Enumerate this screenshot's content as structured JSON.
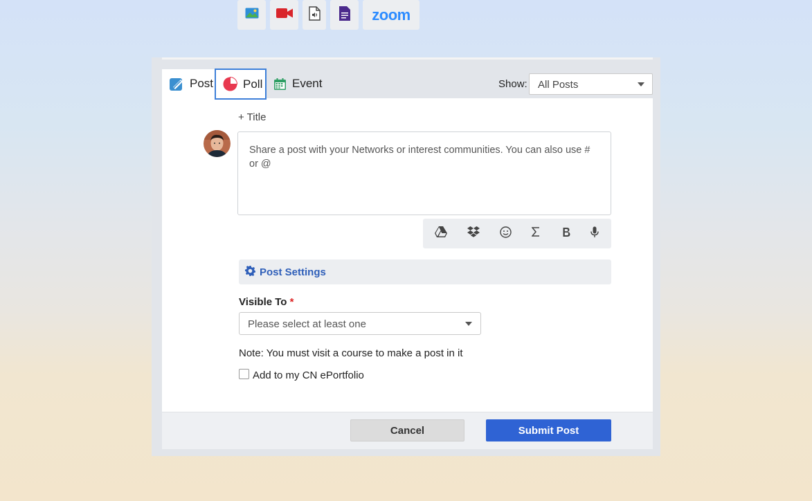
{
  "tabs": [
    {
      "label": "Post",
      "icon": "pen-square-icon"
    },
    {
      "label": "Poll",
      "icon": "pie-chart-icon",
      "selected": true
    },
    {
      "label": "Event",
      "icon": "calendar-icon"
    }
  ],
  "filter": {
    "label": "Show:",
    "value": "All Posts"
  },
  "composer": {
    "add_title": "+ Title",
    "placeholder": "Share a post with your Networks or interest communities. You can also use # or @"
  },
  "toolbar": {
    "items": [
      "image-icon",
      "video-camera-icon",
      "audio-file-icon",
      "document-icon",
      "zoom-logo",
      "google-drive-icon",
      "dropbox-icon",
      "emoji-icon",
      "sigma-icon",
      "bold-icon",
      "microphone-icon"
    ],
    "zoom_label": "zoom"
  },
  "settings": {
    "label": "Post Settings"
  },
  "visibility": {
    "label": "Visible To",
    "required_mark": "*",
    "placeholder": "Please select at least one"
  },
  "note": "Note: You must visit a course to make a post in it",
  "eportfolio": {
    "label": "Add to my CN ePortfolio",
    "checked": false
  },
  "actions": {
    "cancel": "Cancel",
    "submit": "Submit Post"
  },
  "colors": {
    "accent": "#2f63d4",
    "selected_tab_border": "#3d7fd9",
    "zoom_blue": "#2d8cff"
  }
}
